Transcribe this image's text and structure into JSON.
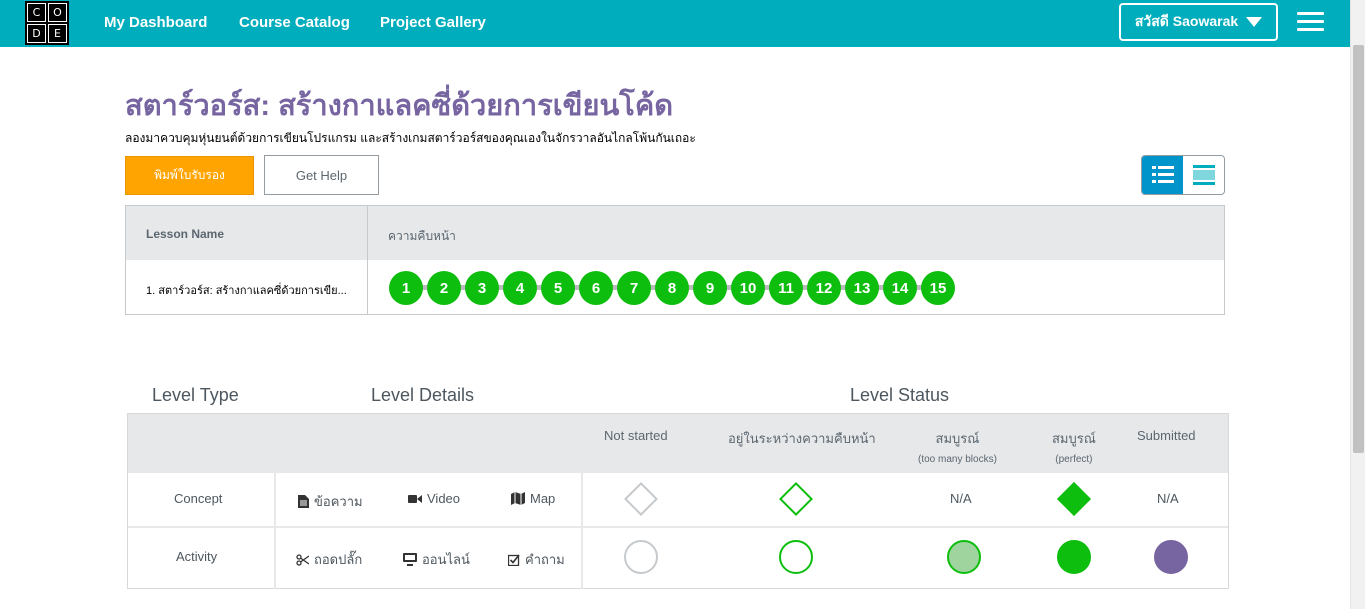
{
  "topbar": {
    "logo_letters": [
      "C",
      "O",
      "D",
      "E"
    ],
    "nav": [
      "My Dashboard",
      "Course Catalog",
      "Project Gallery"
    ],
    "user_label": "สวัสดี Saowarak",
    "colors": {
      "bar": "#00adbc"
    }
  },
  "course": {
    "title": "สตาร์วอร์ส: สร้างกาแลคซี่ด้วยการเขียนโค้ด",
    "description": "ลองมาควบคุมหุ่นยนต์ด้วยการเขียนโปรแกรม และสร้างเกมสตาร์วอร์สของคุณเองในจักรวาลอันไกลโพ้นกันเถอะ",
    "certificate_button": "พิมพ์ใบรับรอง",
    "help_button": "Get Help"
  },
  "lesson_table": {
    "col_lesson": "Lesson Name",
    "col_progress": "ความคืบหน้า",
    "lesson_name": "1. สตาร์วอร์ส: สร้างกาแลคซี่ด้วยการเขีย...",
    "levels": [
      "1",
      "2",
      "3",
      "4",
      "5",
      "6",
      "7",
      "8",
      "9",
      "10",
      "11",
      "12",
      "13",
      "14",
      "15"
    ],
    "level_color": "#0ebe0e"
  },
  "key": {
    "level_type": "Level Type",
    "level_details": "Level Details",
    "level_status": "Level Status",
    "status_headers": {
      "not_started": "Not started",
      "in_progress": "อยู่ในระหว่างความคืบหน้า",
      "complete_too_many": "สมบูรณ์",
      "complete_too_many_sub": "(too many blocks)",
      "complete_perfect": "สมบูรณ์",
      "complete_perfect_sub": "(perfect)",
      "submitted": "Submitted"
    },
    "concept": {
      "type": "Concept",
      "details": [
        "ข้อความ",
        "Video",
        "Map"
      ],
      "too_many": "N/A",
      "submitted": "N/A"
    },
    "activity": {
      "type": "Activity",
      "details": [
        "ถอดปลั๊ก",
        "ออนไลน์",
        "คำถาม"
      ]
    },
    "colors": {
      "green": "#0ebe0e",
      "light_green": "#9fd49f",
      "purple": "#7665a0",
      "gray": "#c6cacd"
    }
  }
}
